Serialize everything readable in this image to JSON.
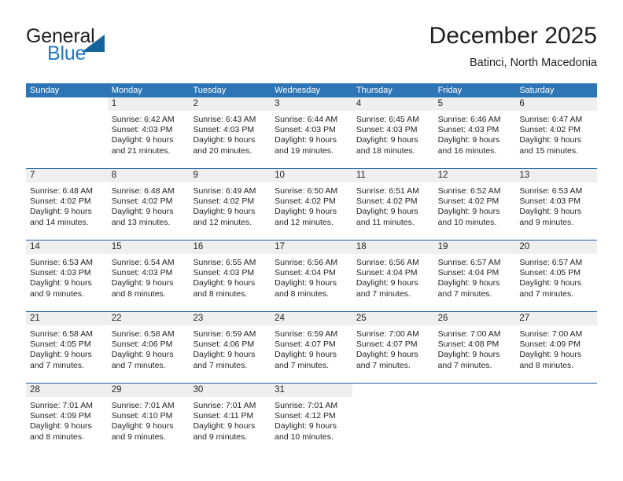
{
  "logo": {
    "primary_text": "General",
    "secondary_text": "Blue",
    "primary_color": "#231f20",
    "secondary_color": "#2079c4",
    "triangle_color": "#14639f"
  },
  "header": {
    "title": "December 2025",
    "subtitle": "Batinci, North Macedonia"
  },
  "theme": {
    "header_bg": "#2e75b6",
    "header_text": "#ffffff",
    "week_divider": "#1f5fa8",
    "day_band_bg": "#efefef",
    "cell_bg": "#ffffff",
    "text": "#231f20"
  },
  "weekdays": [
    "Sunday",
    "Monday",
    "Tuesday",
    "Wednesday",
    "Thursday",
    "Friday",
    "Saturday"
  ],
  "weeks": [
    [
      {
        "day": "",
        "blank": true,
        "sunrise": "",
        "sunset": "",
        "daylight_line1": "",
        "daylight_line2": ""
      },
      {
        "day": "1",
        "sunrise": "Sunrise: 6:42 AM",
        "sunset": "Sunset: 4:03 PM",
        "daylight_line1": "Daylight: 9 hours",
        "daylight_line2": "and 21 minutes."
      },
      {
        "day": "2",
        "sunrise": "Sunrise: 6:43 AM",
        "sunset": "Sunset: 4:03 PM",
        "daylight_line1": "Daylight: 9 hours",
        "daylight_line2": "and 20 minutes."
      },
      {
        "day": "3",
        "sunrise": "Sunrise: 6:44 AM",
        "sunset": "Sunset: 4:03 PM",
        "daylight_line1": "Daylight: 9 hours",
        "daylight_line2": "and 19 minutes."
      },
      {
        "day": "4",
        "sunrise": "Sunrise: 6:45 AM",
        "sunset": "Sunset: 4:03 PM",
        "daylight_line1": "Daylight: 9 hours",
        "daylight_line2": "and 18 minutes."
      },
      {
        "day": "5",
        "sunrise": "Sunrise: 6:46 AM",
        "sunset": "Sunset: 4:03 PM",
        "daylight_line1": "Daylight: 9 hours",
        "daylight_line2": "and 16 minutes."
      },
      {
        "day": "6",
        "sunrise": "Sunrise: 6:47 AM",
        "sunset": "Sunset: 4:02 PM",
        "daylight_line1": "Daylight: 9 hours",
        "daylight_line2": "and 15 minutes."
      }
    ],
    [
      {
        "day": "7",
        "sunrise": "Sunrise: 6:48 AM",
        "sunset": "Sunset: 4:02 PM",
        "daylight_line1": "Daylight: 9 hours",
        "daylight_line2": "and 14 minutes."
      },
      {
        "day": "8",
        "sunrise": "Sunrise: 6:48 AM",
        "sunset": "Sunset: 4:02 PM",
        "daylight_line1": "Daylight: 9 hours",
        "daylight_line2": "and 13 minutes."
      },
      {
        "day": "9",
        "sunrise": "Sunrise: 6:49 AM",
        "sunset": "Sunset: 4:02 PM",
        "daylight_line1": "Daylight: 9 hours",
        "daylight_line2": "and 12 minutes."
      },
      {
        "day": "10",
        "sunrise": "Sunrise: 6:50 AM",
        "sunset": "Sunset: 4:02 PM",
        "daylight_line1": "Daylight: 9 hours",
        "daylight_line2": "and 12 minutes."
      },
      {
        "day": "11",
        "sunrise": "Sunrise: 6:51 AM",
        "sunset": "Sunset: 4:02 PM",
        "daylight_line1": "Daylight: 9 hours",
        "daylight_line2": "and 11 minutes."
      },
      {
        "day": "12",
        "sunrise": "Sunrise: 6:52 AM",
        "sunset": "Sunset: 4:02 PM",
        "daylight_line1": "Daylight: 9 hours",
        "daylight_line2": "and 10 minutes."
      },
      {
        "day": "13",
        "sunrise": "Sunrise: 6:53 AM",
        "sunset": "Sunset: 4:03 PM",
        "daylight_line1": "Daylight: 9 hours",
        "daylight_line2": "and 9 minutes."
      }
    ],
    [
      {
        "day": "14",
        "sunrise": "Sunrise: 6:53 AM",
        "sunset": "Sunset: 4:03 PM",
        "daylight_line1": "Daylight: 9 hours",
        "daylight_line2": "and 9 minutes."
      },
      {
        "day": "15",
        "sunrise": "Sunrise: 6:54 AM",
        "sunset": "Sunset: 4:03 PM",
        "daylight_line1": "Daylight: 9 hours",
        "daylight_line2": "and 8 minutes."
      },
      {
        "day": "16",
        "sunrise": "Sunrise: 6:55 AM",
        "sunset": "Sunset: 4:03 PM",
        "daylight_line1": "Daylight: 9 hours",
        "daylight_line2": "and 8 minutes."
      },
      {
        "day": "17",
        "sunrise": "Sunrise: 6:56 AM",
        "sunset": "Sunset: 4:04 PM",
        "daylight_line1": "Daylight: 9 hours",
        "daylight_line2": "and 8 minutes."
      },
      {
        "day": "18",
        "sunrise": "Sunrise: 6:56 AM",
        "sunset": "Sunset: 4:04 PM",
        "daylight_line1": "Daylight: 9 hours",
        "daylight_line2": "and 7 minutes."
      },
      {
        "day": "19",
        "sunrise": "Sunrise: 6:57 AM",
        "sunset": "Sunset: 4:04 PM",
        "daylight_line1": "Daylight: 9 hours",
        "daylight_line2": "and 7 minutes."
      },
      {
        "day": "20",
        "sunrise": "Sunrise: 6:57 AM",
        "sunset": "Sunset: 4:05 PM",
        "daylight_line1": "Daylight: 9 hours",
        "daylight_line2": "and 7 minutes."
      }
    ],
    [
      {
        "day": "21",
        "sunrise": "Sunrise: 6:58 AM",
        "sunset": "Sunset: 4:05 PM",
        "daylight_line1": "Daylight: 9 hours",
        "daylight_line2": "and 7 minutes."
      },
      {
        "day": "22",
        "sunrise": "Sunrise: 6:58 AM",
        "sunset": "Sunset: 4:06 PM",
        "daylight_line1": "Daylight: 9 hours",
        "daylight_line2": "and 7 minutes."
      },
      {
        "day": "23",
        "sunrise": "Sunrise: 6:59 AM",
        "sunset": "Sunset: 4:06 PM",
        "daylight_line1": "Daylight: 9 hours",
        "daylight_line2": "and 7 minutes."
      },
      {
        "day": "24",
        "sunrise": "Sunrise: 6:59 AM",
        "sunset": "Sunset: 4:07 PM",
        "daylight_line1": "Daylight: 9 hours",
        "daylight_line2": "and 7 minutes."
      },
      {
        "day": "25",
        "sunrise": "Sunrise: 7:00 AM",
        "sunset": "Sunset: 4:07 PM",
        "daylight_line1": "Daylight: 9 hours",
        "daylight_line2": "and 7 minutes."
      },
      {
        "day": "26",
        "sunrise": "Sunrise: 7:00 AM",
        "sunset": "Sunset: 4:08 PM",
        "daylight_line1": "Daylight: 9 hours",
        "daylight_line2": "and 7 minutes."
      },
      {
        "day": "27",
        "sunrise": "Sunrise: 7:00 AM",
        "sunset": "Sunset: 4:09 PM",
        "daylight_line1": "Daylight: 9 hours",
        "daylight_line2": "and 8 minutes."
      }
    ],
    [
      {
        "day": "28",
        "sunrise": "Sunrise: 7:01 AM",
        "sunset": "Sunset: 4:09 PM",
        "daylight_line1": "Daylight: 9 hours",
        "daylight_line2": "and 8 minutes."
      },
      {
        "day": "29",
        "sunrise": "Sunrise: 7:01 AM",
        "sunset": "Sunset: 4:10 PM",
        "daylight_line1": "Daylight: 9 hours",
        "daylight_line2": "and 9 minutes."
      },
      {
        "day": "30",
        "sunrise": "Sunrise: 7:01 AM",
        "sunset": "Sunset: 4:11 PM",
        "daylight_line1": "Daylight: 9 hours",
        "daylight_line2": "and 9 minutes."
      },
      {
        "day": "31",
        "sunrise": "Sunrise: 7:01 AM",
        "sunset": "Sunset: 4:12 PM",
        "daylight_line1": "Daylight: 9 hours",
        "daylight_line2": "and 10 minutes."
      },
      {
        "day": "",
        "blank": true,
        "sunrise": "",
        "sunset": "",
        "daylight_line1": "",
        "daylight_line2": ""
      },
      {
        "day": "",
        "blank": true,
        "sunrise": "",
        "sunset": "",
        "daylight_line1": "",
        "daylight_line2": ""
      },
      {
        "day": "",
        "blank": true,
        "sunrise": "",
        "sunset": "",
        "daylight_line1": "",
        "daylight_line2": ""
      }
    ]
  ]
}
